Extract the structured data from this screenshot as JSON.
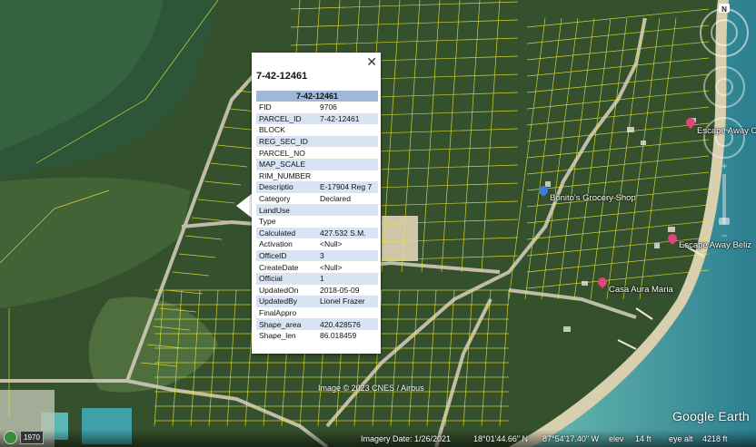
{
  "popup": {
    "title": "7-42-12461",
    "table_header": "7-42-12461",
    "close_glyph": "✕",
    "rows": [
      {
        "key": "FID",
        "value": "9706"
      },
      {
        "key": "PARCEL_ID",
        "value": "7-42-12461"
      },
      {
        "key": "BLOCK",
        "value": ""
      },
      {
        "key": "REG_SEC_ID",
        "value": ""
      },
      {
        "key": "PARCEL_NO",
        "value": ""
      },
      {
        "key": "MAP_SCALE",
        "value": ""
      },
      {
        "key": "RIM_NUMBER",
        "value": ""
      },
      {
        "key": "Descriptio",
        "value": "E-17904 Reg 7"
      },
      {
        "key": "Category",
        "value": "Declared"
      },
      {
        "key": "LandUse",
        "value": ""
      },
      {
        "key": "Type",
        "value": ""
      },
      {
        "key": "Calculated",
        "value": "427.532 S.M."
      },
      {
        "key": "Activation",
        "value": "<Null>"
      },
      {
        "key": "OfficeID",
        "value": "3"
      },
      {
        "key": "CreateDate",
        "value": "<Null>"
      },
      {
        "key": "Official",
        "value": "1"
      },
      {
        "key": "UpdatedOn",
        "value": "2018-05-09"
      },
      {
        "key": "UpdatedBy",
        "value": "Lionel Frazer"
      },
      {
        "key": "FinalAppro",
        "value": ""
      },
      {
        "key": "Shape_area",
        "value": "420.428576"
      },
      {
        "key": "Shape_len",
        "value": "86.018459"
      }
    ]
  },
  "places": [
    {
      "label": "Escape Away C",
      "pin_color": "#e0457b"
    },
    {
      "label": "Bonito's Grocery Shop",
      "pin_color": "#3b7ddd"
    },
    {
      "label": "Escape Away Beliz",
      "pin_color": "#e0457b"
    },
    {
      "label": "Casa Aura Maria",
      "pin_color": "#e0457b"
    }
  ],
  "map": {
    "copyright": "Image © 2023 CNES / Airbus",
    "logo": "Google Earth",
    "compass_letter": "N"
  },
  "status": {
    "history_year": "1970",
    "imagery_date": "Imagery Date: 1/26/2021",
    "latitude": "18°01'44.66\" N",
    "longitude": "87°54'17.40\" W",
    "elev_label": "elev",
    "elev_value": "14 ft",
    "eye_alt_label": "eye alt",
    "eye_alt_value": "4218 ft"
  },
  "colors": {
    "parcel_lines": "#e8e83a",
    "table_header": "#9fb8d9",
    "table_alt_row": "#d8e4f3",
    "sea": "#4aa3a8",
    "lagoon": "#2c5a3c"
  }
}
